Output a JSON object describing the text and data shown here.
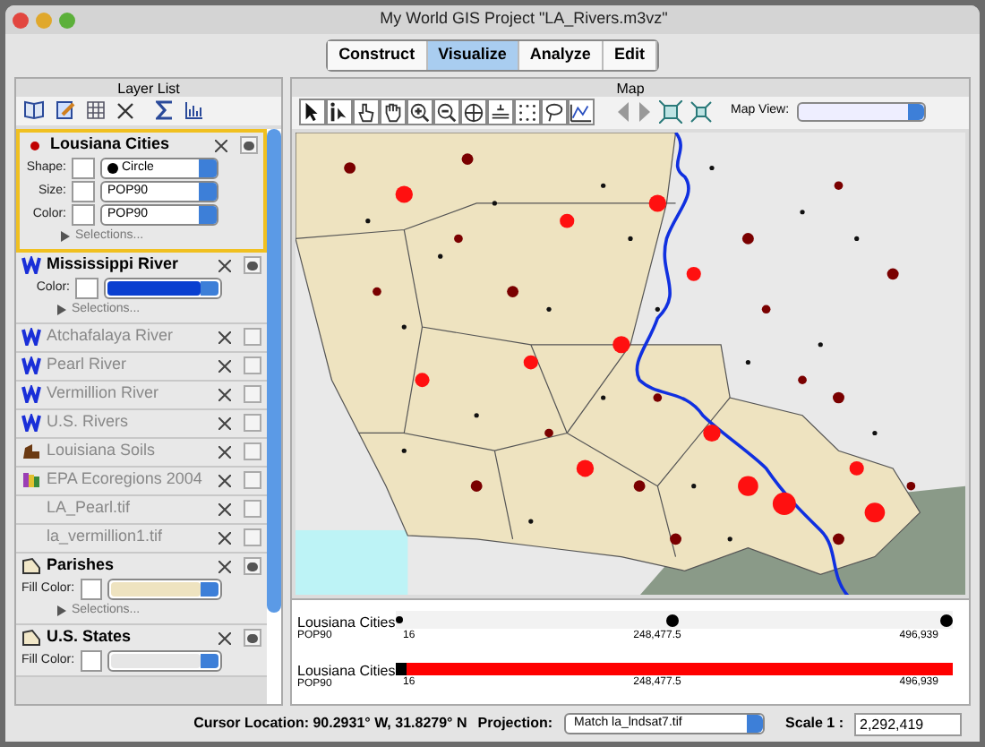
{
  "window": {
    "title": "My World GIS Project \"LA_Rivers.m3vz\""
  },
  "tabs": [
    {
      "label": "Construct",
      "selected": false
    },
    {
      "label": "Visualize",
      "selected": true
    },
    {
      "label": "Analyze",
      "selected": false
    },
    {
      "label": "Edit",
      "selected": false
    }
  ],
  "layer_list": {
    "title": "Layer List",
    "layers": [
      {
        "name": "Lousiana Cities",
        "kind": "point",
        "selected": true,
        "visible": true,
        "properties": [
          {
            "label": "Shape:",
            "kind": "shape",
            "value": "Circle"
          },
          {
            "label": "Size:",
            "kind": "select",
            "value": "POP90"
          },
          {
            "label": "Color:",
            "kind": "select",
            "value": "POP90"
          }
        ],
        "selections": "Selections..."
      },
      {
        "name": "Mississippi  River",
        "kind": "river",
        "selected": false,
        "visible": true,
        "properties": [
          {
            "label": "Color:",
            "kind": "color",
            "color": "#0a3fd0"
          }
        ],
        "selections": "Selections..."
      },
      {
        "name": "Atchafalaya River",
        "kind": "river",
        "selected": false,
        "visible": false
      },
      {
        "name": "Pearl River",
        "kind": "river",
        "selected": false,
        "visible": false
      },
      {
        "name": "Vermillion River",
        "kind": "river",
        "selected": false,
        "visible": false
      },
      {
        "name": "U.S. Rivers",
        "kind": "river",
        "selected": false,
        "visible": false
      },
      {
        "name": "Louisiana Soils",
        "kind": "soil",
        "selected": false,
        "visible": false
      },
      {
        "name": "EPA Ecoregions 2004",
        "kind": "eco",
        "selected": false,
        "visible": false
      },
      {
        "name": "LA_Pearl.tif",
        "kind": "raster",
        "selected": false,
        "visible": false
      },
      {
        "name": "la_vermillion1.tif",
        "kind": "raster",
        "selected": false,
        "visible": false
      },
      {
        "name": "Parishes",
        "kind": "polygon",
        "selected": false,
        "visible": true,
        "properties": [
          {
            "label": "Fill Color:",
            "kind": "color",
            "color": "#eee3c0"
          }
        ],
        "selections": "Selections..."
      },
      {
        "name": "U.S. States",
        "kind": "polygon",
        "selected": false,
        "visible": true,
        "properties": [
          {
            "label": "Fill Color:",
            "kind": "color",
            "color": "#e6e6e6"
          }
        ]
      }
    ]
  },
  "map": {
    "title": "Map",
    "map_view_label": "Map View:",
    "legends": [
      {
        "kind": "size",
        "layer": "Lousiana Cities",
        "field": "POP90",
        "ticks": [
          "16",
          "248,477.5",
          "496,939"
        ]
      },
      {
        "kind": "color",
        "layer": "Lousiana Cities",
        "field": "POP90",
        "ticks": [
          "16",
          "248,477.5",
          "496,939"
        ]
      }
    ]
  },
  "status_bar": {
    "cursor_location": "Cursor Location: 90.2931° W, 31.8279° N",
    "projection_label": "Projection:",
    "projection": "Match la_lndsat7.tif",
    "scale_label": "Scale 1 :",
    "scale": "2,292,419"
  }
}
